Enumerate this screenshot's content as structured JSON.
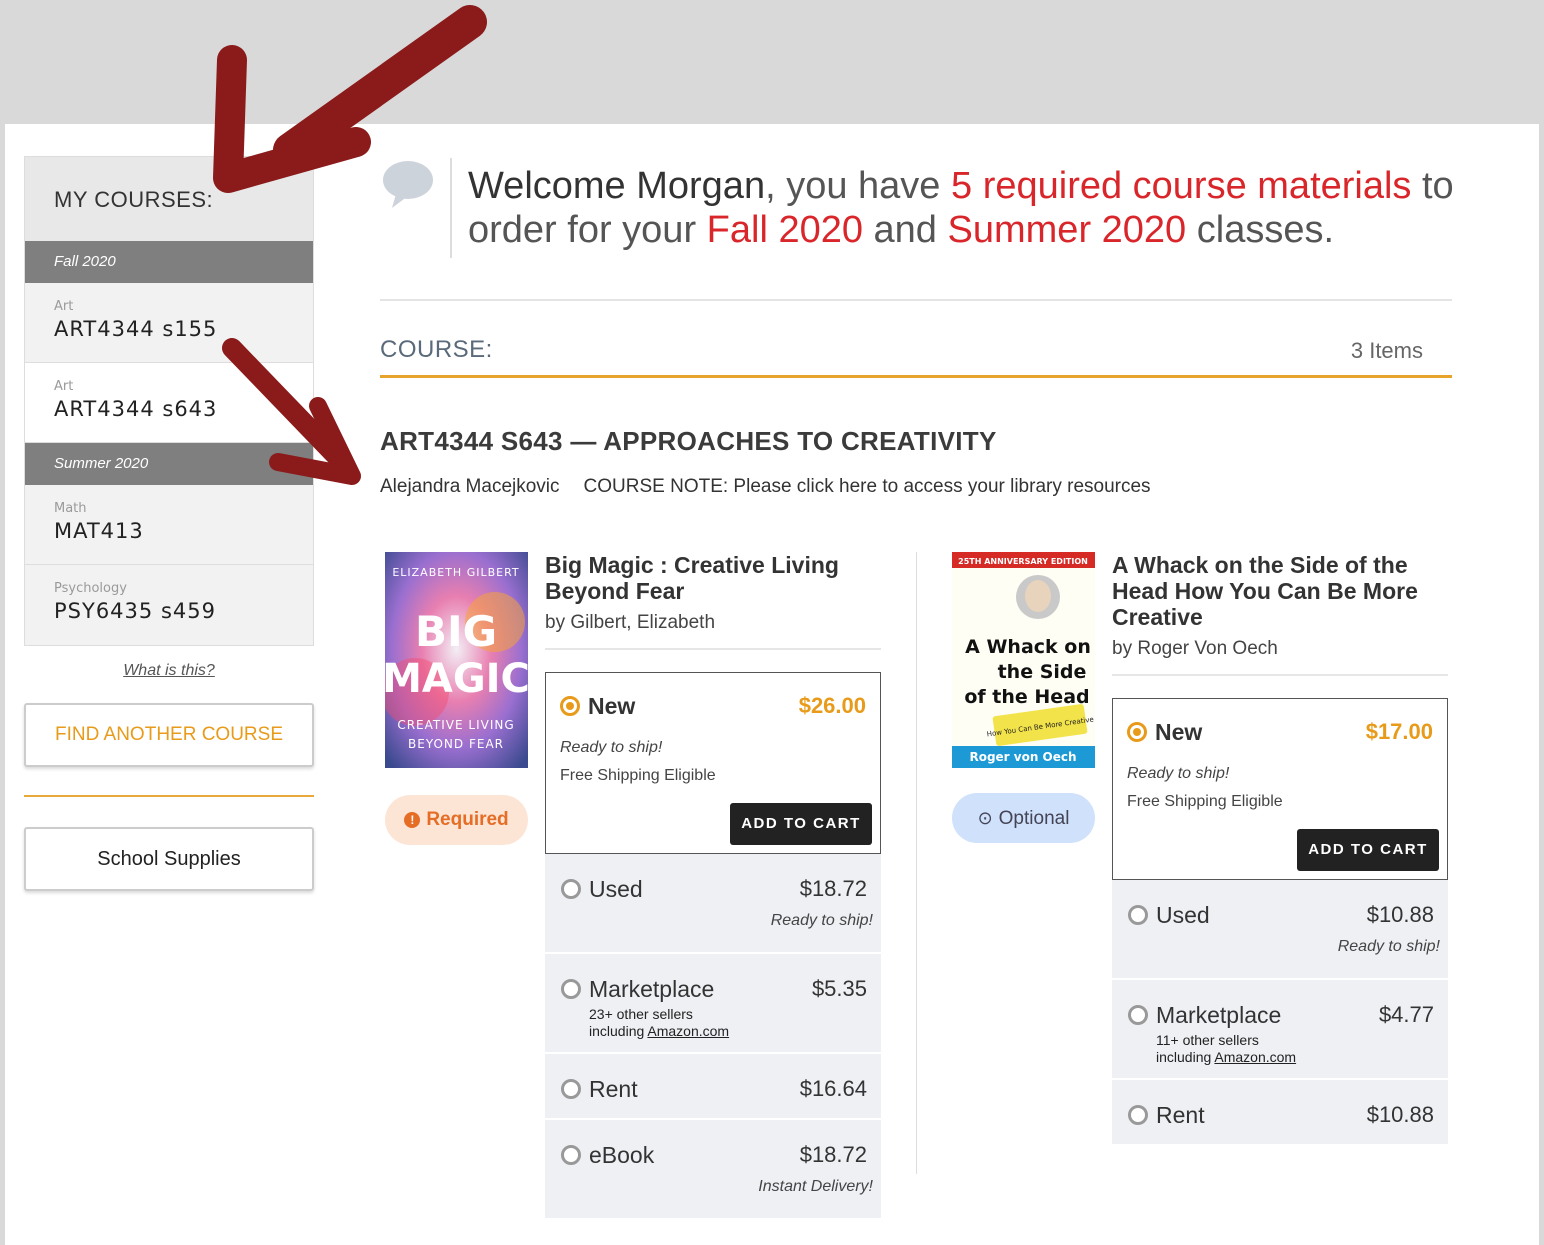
{
  "sidebar": {
    "heading": "MY COURSES:",
    "terms": [
      {
        "label": "Fall 2020",
        "courses": [
          {
            "subject": "Art",
            "code": "ART4344 s155"
          },
          {
            "subject": "Art",
            "code": "ART4344 s643"
          }
        ]
      },
      {
        "label": "Summer 2020",
        "courses": [
          {
            "subject": "Math",
            "code": "MAT413"
          },
          {
            "subject": "Psychology",
            "code": "PSY6435 s459"
          }
        ]
      }
    ],
    "what_is_this": "What is this?",
    "find_button": "FIND ANOTHER COURSE",
    "supplies_button": "School Supplies"
  },
  "welcome": {
    "greeting": "Welcome Morgan",
    "part1": ", you have ",
    "required": "5 required course materials",
    "part2": " to order for your ",
    "term1": "Fall 2020",
    "part3": " and ",
    "term2": "Summer 2020",
    "part4": " classes."
  },
  "course_header": {
    "label": "COURSE:",
    "items": "3 Items"
  },
  "course": {
    "title": "ART4344 S643 — APPROACHES TO CREATIVITY",
    "instructor": "Alejandra Macejkovic",
    "note": "COURSE NOTE: Please click here to access your library resources"
  },
  "books": [
    {
      "title": "Big Magic : Creative Living Beyond Fear",
      "author": "by Gilbert, Elizabeth",
      "badge": "Required",
      "cover": {
        "line1": "ELIZABETH GILBERT",
        "line2": "BIG",
        "line3": "MAGIC",
        "line4": "CREATIVE LIVING",
        "line5": "BEYOND FEAR"
      },
      "new": {
        "label": "New",
        "price": "$26.00",
        "status": "Ready to ship!",
        "shipping": "Free Shipping Eligible",
        "cart": "ADD TO CART"
      },
      "used": {
        "label": "Used",
        "price": "$18.72",
        "status": "Ready to ship!"
      },
      "marketplace": {
        "label": "Marketplace",
        "price": "$5.35",
        "sellers": "23+ other sellers",
        "including": "including ",
        "store": "Amazon.com"
      },
      "rent": {
        "label": "Rent",
        "price": "$16.64"
      },
      "ebook": {
        "label": "eBook",
        "price": "$18.72",
        "status": "Instant Delivery!"
      }
    },
    {
      "title": "A Whack on the Side of the Head How You Can Be More Creative",
      "author": "by Roger Von Oech",
      "badge": "Optional",
      "cover": {
        "line1": "25TH ANNIVERSARY EDITION",
        "line2": "A Whack on",
        "line3": "the Side",
        "line4": "of the Head",
        "line5": "How You Can Be More Creative",
        "line6": "Roger von Oech"
      },
      "new": {
        "label": "New",
        "price": "$17.00",
        "status": "Ready to ship!",
        "shipping": "Free Shipping Eligible",
        "cart": "ADD TO CART"
      },
      "used": {
        "label": "Used",
        "price": "$10.88",
        "status": "Ready to ship!"
      },
      "marketplace": {
        "label": "Marketplace",
        "price": "$4.77",
        "sellers": "11+ other sellers",
        "including": "including ",
        "store": "Amazon.com"
      },
      "rent": {
        "label": "Rent",
        "price": "$10.88"
      }
    }
  ],
  "colors": {
    "accent": "#e89b1a",
    "highlight": "#d9262b",
    "annotation_arrow": "#8b1a1a"
  }
}
